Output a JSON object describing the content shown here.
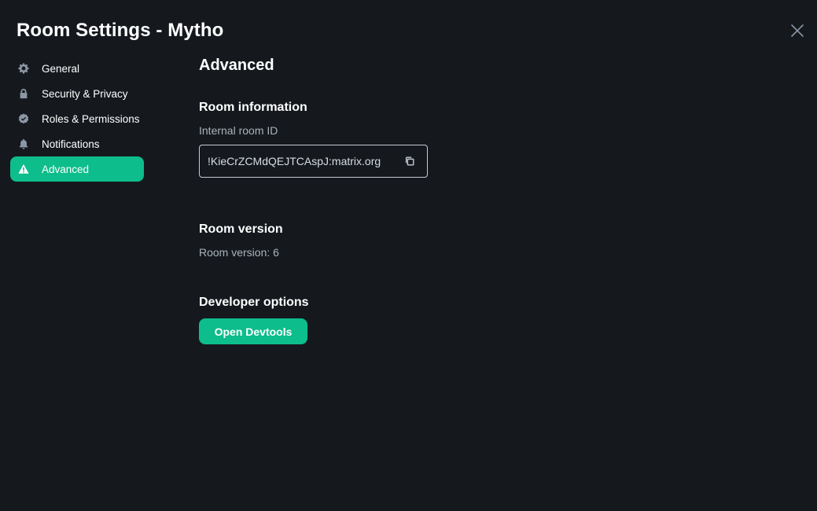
{
  "dialog": {
    "title": "Room Settings - Mytho",
    "close_icon": "close-icon"
  },
  "sidebar": {
    "items": [
      {
        "label": "General",
        "icon": "gear-icon",
        "active": false
      },
      {
        "label": "Security & Privacy",
        "icon": "lock-icon",
        "active": false
      },
      {
        "label": "Roles & Permissions",
        "icon": "shield-check-icon",
        "active": false
      },
      {
        "label": "Notifications",
        "icon": "bell-icon",
        "active": false
      },
      {
        "label": "Advanced",
        "icon": "warning-icon",
        "active": true
      }
    ]
  },
  "main": {
    "heading": "Advanced",
    "room_information": {
      "title": "Room information",
      "room_id_label": "Internal room ID",
      "room_id_value": "!KieCrZCMdQEJTCAspJ:matrix.org",
      "copy_icon": "copy-icon"
    },
    "room_version": {
      "title": "Room version",
      "text": "Room version: 6"
    },
    "developer_options": {
      "title": "Developer options",
      "button_label": "Open Devtools"
    }
  },
  "colors": {
    "background": "#15191e",
    "accent": "#0dbd8b",
    "text": "#ffffff",
    "muted_text": "#a9b2bc"
  }
}
